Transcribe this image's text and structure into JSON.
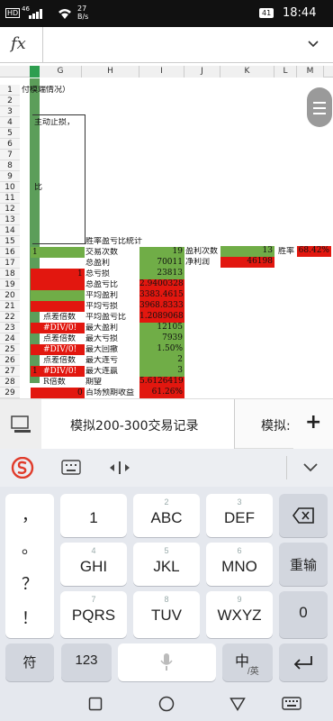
{
  "status": {
    "carrier_tag": "HD",
    "signal": "46",
    "speed_value": "27",
    "speed_unit": "B/s",
    "battery": "41",
    "time": "18:44"
  },
  "formula_bar": {
    "fx_label": "fx",
    "value": ""
  },
  "columns": [
    "G",
    "H",
    "I",
    "J",
    "K",
    "L",
    "M"
  ],
  "rows": [
    "1",
    "2",
    "3",
    "4",
    "5",
    "6",
    "7",
    "8",
    "9",
    "10",
    "11",
    "12",
    "13",
    "14",
    "15",
    "16",
    "17",
    "18",
    "19",
    "20",
    "21",
    "22",
    "23",
    "24",
    "25",
    "26",
    "27",
    "28",
    "29"
  ],
  "sheet": {
    "r1_g": "付模端情况）",
    "r4_g": "主动止损，",
    "r10_g": "比",
    "r15_title": "胜率盈亏比统计",
    "r16_g": "1",
    "r27_g": "1",
    "r28_g": "R倍数",
    "stats": [
      {
        "label": "交易次数",
        "value": "19",
        "color": "g"
      },
      {
        "label": "总盈利",
        "value": "70011",
        "color": "g"
      },
      {
        "label": "总亏损",
        "value": "23813",
        "color": "g"
      },
      {
        "label": "总盈亏比",
        "value": "2.9400328",
        "color": "r"
      },
      {
        "label": "平均盈利",
        "value": "3383.4615",
        "color": "r"
      },
      {
        "label": "平均亏损",
        "value": "3968.8333",
        "color": "r"
      },
      {
        "label": "平均盈亏比",
        "value": "1.2089068",
        "color": "r"
      },
      {
        "label": "最大盈利",
        "value": "12105",
        "color": "g"
      },
      {
        "label": "最大亏损",
        "value": "7939",
        "color": "g"
      },
      {
        "label": "最大回撤",
        "value": "1.50%",
        "color": "g"
      },
      {
        "label": "最大连亏",
        "value": "2",
        "color": "g"
      },
      {
        "label": "最大连赢",
        "value": "3",
        "color": "g"
      },
      {
        "label": "期望",
        "value": "5.6126419",
        "color": "r"
      },
      {
        "label": "百场预期收益",
        "value": "61.26%",
        "color": "r"
      }
    ],
    "right_stats": [
      {
        "label": "盈利次数",
        "value": "13"
      },
      {
        "label": "净利润",
        "value": "46198"
      }
    ],
    "winrate_label": "胜率",
    "winrate_value": "68.42%",
    "left_rows": [
      {
        "row": "22",
        "text": "点差倍数"
      },
      {
        "row": "23",
        "text": "#DIV/0!"
      },
      {
        "row": "24",
        "text": "点差倍数"
      },
      {
        "row": "25",
        "text": "#DIV/0!"
      },
      {
        "row": "26",
        "text": "点差倍数"
      },
      {
        "row": "27",
        "text": "#DIV/0!"
      }
    ],
    "g18_value": "1",
    "h29_value": "0"
  },
  "sheet_tabs": {
    "active": "模拟200-300交易记录",
    "next": "模拟:",
    "add": "+"
  },
  "keyboard": {
    "toolbar": [
      "sogou-logo",
      "keyboard-icon",
      "cursor-icon",
      "chevron-down-icon"
    ],
    "left_column": [
      "，",
      "。",
      "？",
      "！"
    ],
    "keys": [
      {
        "sub": "",
        "main": "1"
      },
      {
        "sub": "2",
        "main": "ABC"
      },
      {
        "sub": "3",
        "main": "DEF"
      },
      {
        "sub": "4",
        "main": "GHI"
      },
      {
        "sub": "5",
        "main": "JKL"
      },
      {
        "sub": "6",
        "main": "MNO"
      },
      {
        "sub": "7",
        "main": "PQRS"
      },
      {
        "sub": "8",
        "main": "TUV"
      },
      {
        "sub": "9",
        "main": "WXYZ"
      }
    ],
    "rightcol": {
      "reenter": "重输",
      "zero": "0"
    },
    "bottom": {
      "symbol": "符",
      "num": "123",
      "lang_main": "中",
      "lang_sub": "/英"
    }
  }
}
